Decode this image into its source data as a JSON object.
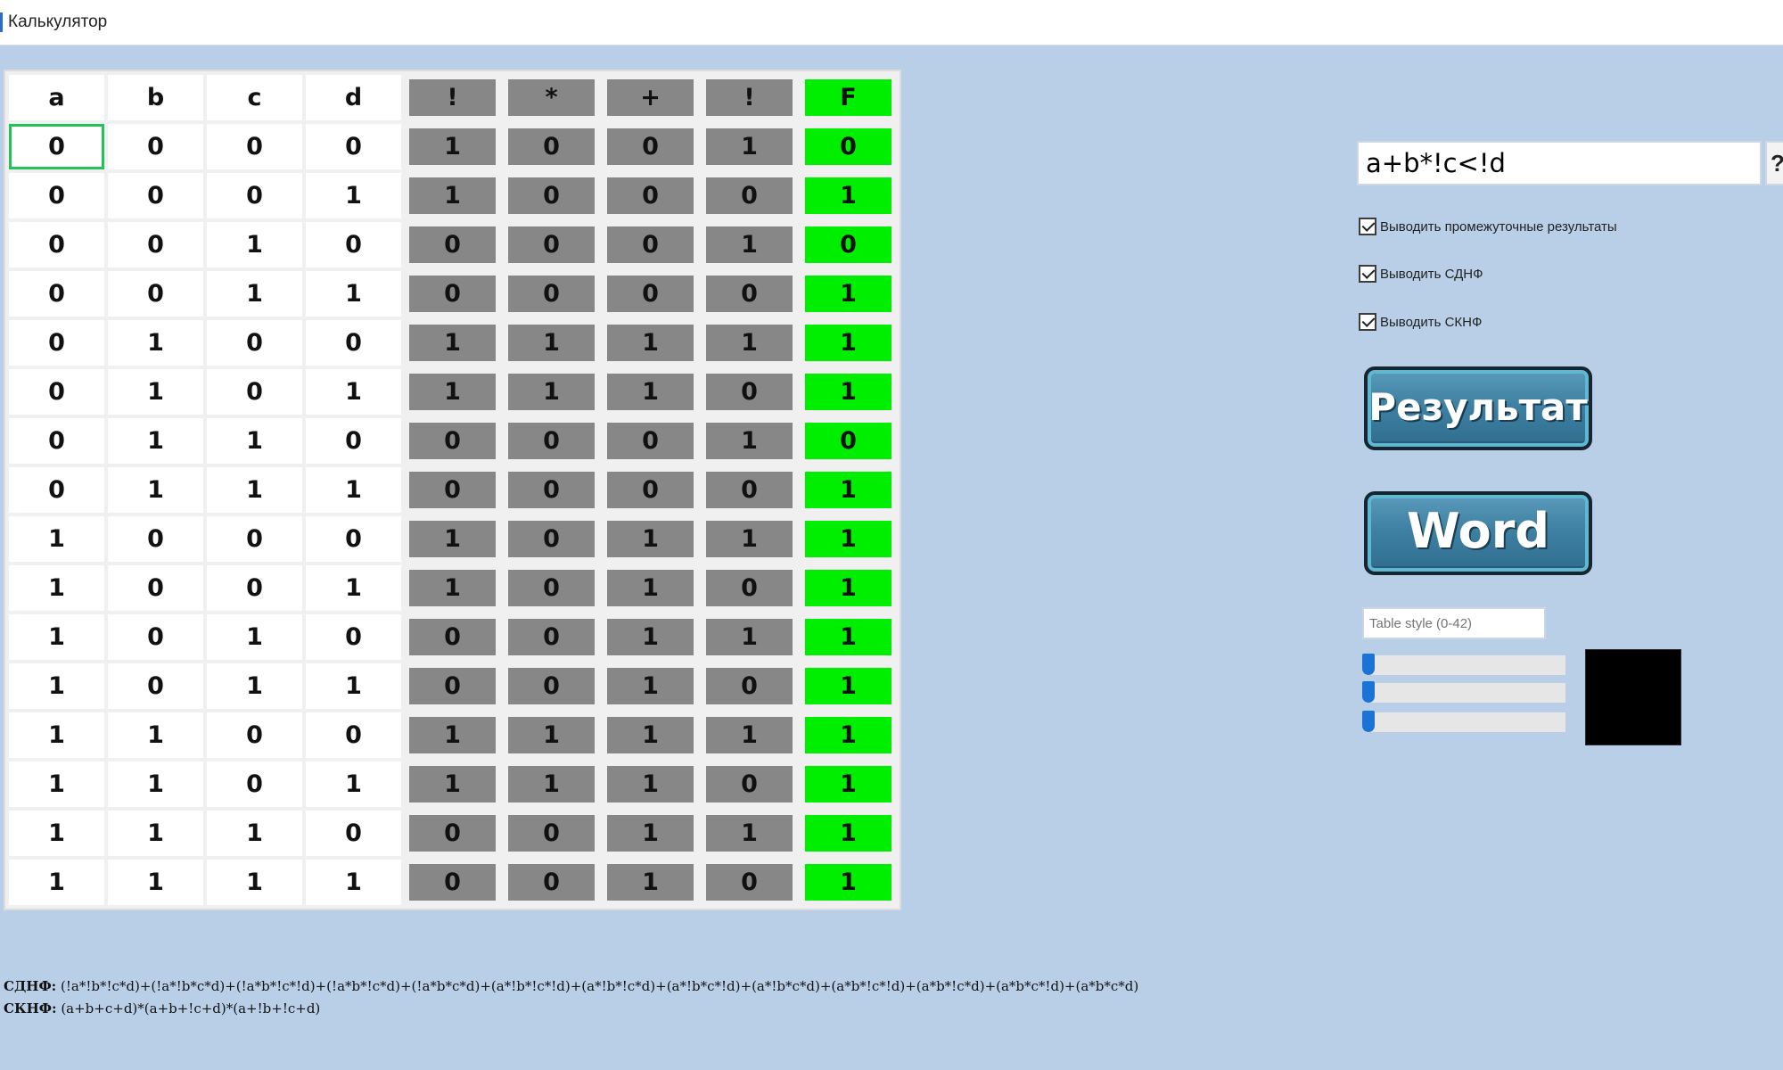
{
  "window": {
    "title": "Калькулятор"
  },
  "table": {
    "headers": [
      "a",
      "b",
      "c",
      "d",
      "!",
      "*",
      "+",
      "!",
      "F"
    ],
    "rows": [
      [
        "0",
        "0",
        "0",
        "0",
        "1",
        "0",
        "0",
        "1",
        "0"
      ],
      [
        "0",
        "0",
        "0",
        "1",
        "1",
        "0",
        "0",
        "0",
        "1"
      ],
      [
        "0",
        "0",
        "1",
        "0",
        "0",
        "0",
        "0",
        "1",
        "0"
      ],
      [
        "0",
        "0",
        "1",
        "1",
        "0",
        "0",
        "0",
        "0",
        "1"
      ],
      [
        "0",
        "1",
        "0",
        "0",
        "1",
        "1",
        "1",
        "1",
        "1"
      ],
      [
        "0",
        "1",
        "0",
        "1",
        "1",
        "1",
        "1",
        "0",
        "1"
      ],
      [
        "0",
        "1",
        "1",
        "0",
        "0",
        "0",
        "0",
        "1",
        "0"
      ],
      [
        "0",
        "1",
        "1",
        "1",
        "0",
        "0",
        "0",
        "0",
        "1"
      ],
      [
        "1",
        "0",
        "0",
        "0",
        "1",
        "0",
        "1",
        "1",
        "1"
      ],
      [
        "1",
        "0",
        "0",
        "1",
        "1",
        "0",
        "1",
        "0",
        "1"
      ],
      [
        "1",
        "0",
        "1",
        "0",
        "0",
        "0",
        "1",
        "1",
        "1"
      ],
      [
        "1",
        "0",
        "1",
        "1",
        "0",
        "0",
        "1",
        "0",
        "1"
      ],
      [
        "1",
        "1",
        "0",
        "0",
        "1",
        "1",
        "1",
        "1",
        "1"
      ],
      [
        "1",
        "1",
        "0",
        "1",
        "1",
        "1",
        "1",
        "0",
        "1"
      ],
      [
        "1",
        "1",
        "1",
        "0",
        "0",
        "0",
        "1",
        "1",
        "1"
      ],
      [
        "1",
        "1",
        "1",
        "1",
        "0",
        "0",
        "1",
        "0",
        "1"
      ]
    ],
    "colors": {
      "variable_cell": "#ffffff",
      "operation_cell": "#878787",
      "result_cell": "#00ef00",
      "selected_outline": "#22c45a"
    }
  },
  "panel": {
    "formula_value": "a+b*!c<!d",
    "help_label": "?",
    "checkboxes": [
      {
        "label": "Выводить промежуточные результаты",
        "checked": true
      },
      {
        "label": "Выводить СДНФ",
        "checked": true
      },
      {
        "label": "Выводить СКНФ",
        "checked": true
      }
    ],
    "result_button_label": "Результат",
    "word_button_label": "Word",
    "table_style_placeholder": "Table style (0-42)",
    "sliders": [
      {
        "value": 0
      },
      {
        "value": 0
      },
      {
        "value": 0
      }
    ],
    "swatch_color": "#000000"
  },
  "output": {
    "sdnf_label": "СДНФ:",
    "sdnf_value": "(!a*!b*!c*d)+(!a*!b*c*d)+(!a*b*!c*!d)+(!a*b*!c*d)+(!a*b*c*d)+(a*!b*!c*!d)+(a*!b*!c*d)+(a*!b*c*!d)+(a*!b*c*d)+(a*b*!c*!d)+(a*b*!c*d)+(a*b*c*!d)+(a*b*c*d)",
    "sknf_label": "СКНФ:",
    "sknf_value": "(a+b+c+d)*(a+b+!c+d)*(a+!b+!c+d)"
  }
}
